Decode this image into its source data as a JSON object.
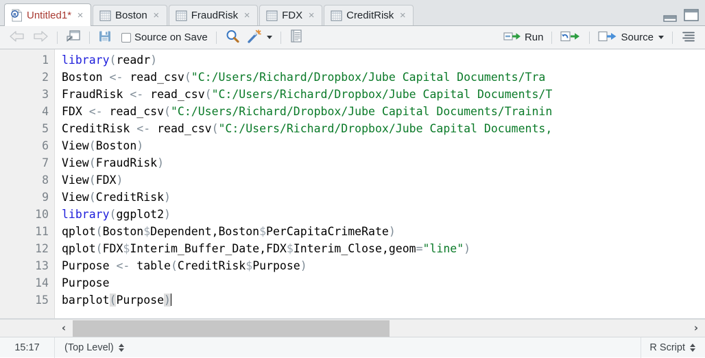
{
  "window": {
    "minimize_label": "minimize-pane",
    "maximize_label": "maximize-pane"
  },
  "tabs": [
    {
      "label": "Untitled1*",
      "icon": "r-script-icon",
      "active": true,
      "close": "×"
    },
    {
      "label": "Boston",
      "icon": "data-grid-icon",
      "active": false,
      "close": "×"
    },
    {
      "label": "FraudRisk",
      "icon": "data-grid-icon",
      "active": false,
      "close": "×"
    },
    {
      "label": "FDX",
      "icon": "data-grid-icon",
      "active": false,
      "close": "×"
    },
    {
      "label": "CreditRisk",
      "icon": "data-grid-icon",
      "active": false,
      "close": "×"
    }
  ],
  "toolbar": {
    "back_icon": "back-arrow-icon",
    "forward_icon": "forward-arrow-icon",
    "popout_icon": "show-in-new-window-icon",
    "save_icon": "save-icon",
    "source_on_save_label": "Source on Save",
    "find_icon": "find-replace-icon",
    "wand_icon": "code-tools-wand-icon",
    "report_icon": "compile-report-icon",
    "run_label": "Run",
    "rerun_icon": "rerun-previous-icon",
    "source_label": "Source",
    "outline_icon": "document-outline-icon"
  },
  "editor": {
    "line_numbers": [
      "1",
      "2",
      "3",
      "4",
      "5",
      "6",
      "7",
      "8",
      "9",
      "10",
      "11",
      "12",
      "13",
      "14",
      "15"
    ],
    "lines": [
      {
        "n": "1",
        "tokens": [
          {
            "t": "library",
            "c": "fn"
          },
          {
            "t": "(",
            "c": "op"
          },
          {
            "t": "readr",
            "c": "txt"
          },
          {
            "t": ")",
            "c": "op"
          }
        ]
      },
      {
        "n": "2",
        "tokens": [
          {
            "t": "Boston ",
            "c": "txt"
          },
          {
            "t": "<-",
            "c": "op"
          },
          {
            "t": " read_csv",
            "c": "txt"
          },
          {
            "t": "(",
            "c": "op"
          },
          {
            "t": "\"C:/Users/Richard/Dropbox/Jube Capital Documents/Tra",
            "c": "str"
          }
        ]
      },
      {
        "n": "3",
        "tokens": [
          {
            "t": "FraudRisk ",
            "c": "txt"
          },
          {
            "t": "<-",
            "c": "op"
          },
          {
            "t": " read_csv",
            "c": "txt"
          },
          {
            "t": "(",
            "c": "op"
          },
          {
            "t": "\"C:/Users/Richard/Dropbox/Jube Capital Documents/T",
            "c": "str"
          }
        ]
      },
      {
        "n": "4",
        "tokens": [
          {
            "t": "FDX ",
            "c": "txt"
          },
          {
            "t": "<-",
            "c": "op"
          },
          {
            "t": " read_csv",
            "c": "txt"
          },
          {
            "t": "(",
            "c": "op"
          },
          {
            "t": "\"C:/Users/Richard/Dropbox/Jube Capital Documents/Trainin",
            "c": "str"
          }
        ]
      },
      {
        "n": "5",
        "tokens": [
          {
            "t": "CreditRisk ",
            "c": "txt"
          },
          {
            "t": "<-",
            "c": "op"
          },
          {
            "t": " read_csv",
            "c": "txt"
          },
          {
            "t": "(",
            "c": "op"
          },
          {
            "t": "\"C:/Users/Richard/Dropbox/Jube Capital Documents,",
            "c": "str"
          }
        ]
      },
      {
        "n": "6",
        "tokens": [
          {
            "t": "View",
            "c": "txt"
          },
          {
            "t": "(",
            "c": "op"
          },
          {
            "t": "Boston",
            "c": "txt"
          },
          {
            "t": ")",
            "c": "op"
          }
        ]
      },
      {
        "n": "7",
        "tokens": [
          {
            "t": "View",
            "c": "txt"
          },
          {
            "t": "(",
            "c": "op"
          },
          {
            "t": "FraudRisk",
            "c": "txt"
          },
          {
            "t": ")",
            "c": "op"
          }
        ]
      },
      {
        "n": "8",
        "tokens": [
          {
            "t": "View",
            "c": "txt"
          },
          {
            "t": "(",
            "c": "op"
          },
          {
            "t": "FDX",
            "c": "txt"
          },
          {
            "t": ")",
            "c": "op"
          }
        ]
      },
      {
        "n": "9",
        "tokens": [
          {
            "t": "View",
            "c": "txt"
          },
          {
            "t": "(",
            "c": "op"
          },
          {
            "t": "CreditRisk",
            "c": "txt"
          },
          {
            "t": ")",
            "c": "op"
          }
        ]
      },
      {
        "n": "10",
        "tokens": [
          {
            "t": "library",
            "c": "fn"
          },
          {
            "t": "(",
            "c": "op"
          },
          {
            "t": "ggplot2",
            "c": "txt"
          },
          {
            "t": ")",
            "c": "op"
          }
        ]
      },
      {
        "n": "11",
        "tokens": [
          {
            "t": "qplot",
            "c": "txt"
          },
          {
            "t": "(",
            "c": "op"
          },
          {
            "t": "Boston",
            "c": "txt"
          },
          {
            "t": "$",
            "c": "dol"
          },
          {
            "t": "Dependent,Boston",
            "c": "txt"
          },
          {
            "t": "$",
            "c": "dol"
          },
          {
            "t": "PerCapitaCrimeRate",
            "c": "txt"
          },
          {
            "t": ")",
            "c": "op"
          }
        ]
      },
      {
        "n": "12",
        "tokens": [
          {
            "t": "qplot",
            "c": "txt"
          },
          {
            "t": "(",
            "c": "op"
          },
          {
            "t": "FDX",
            "c": "txt"
          },
          {
            "t": "$",
            "c": "dol"
          },
          {
            "t": "Interim_Buffer_Date,FDX",
            "c": "txt"
          },
          {
            "t": "$",
            "c": "dol"
          },
          {
            "t": "Interim_Close,geom",
            "c": "txt"
          },
          {
            "t": "=",
            "c": "op"
          },
          {
            "t": "\"line\"",
            "c": "str"
          },
          {
            "t": ")",
            "c": "op"
          }
        ]
      },
      {
        "n": "13",
        "tokens": [
          {
            "t": "Purpose ",
            "c": "txt"
          },
          {
            "t": "<-",
            "c": "op"
          },
          {
            "t": " table",
            "c": "txt"
          },
          {
            "t": "(",
            "c": "op"
          },
          {
            "t": "CreditRisk",
            "c": "txt"
          },
          {
            "t": "$",
            "c": "dol"
          },
          {
            "t": "Purpose",
            "c": "txt"
          },
          {
            "t": ")",
            "c": "op"
          }
        ]
      },
      {
        "n": "14",
        "tokens": [
          {
            "t": "Purpose",
            "c": "txt"
          }
        ]
      },
      {
        "n": "15",
        "tokens": [
          {
            "t": "barplot",
            "c": "txt"
          },
          {
            "t": "(",
            "c": "op",
            "match": true
          },
          {
            "t": "Purpose",
            "c": "txt"
          },
          {
            "t": ")",
            "c": "op",
            "match": true
          },
          {
            "t": "",
            "c": "caret"
          }
        ]
      }
    ]
  },
  "scrollbar": {
    "left_arrow": "‹",
    "right_arrow": "›"
  },
  "statusbar": {
    "cursor_position": "15:17",
    "scope": "(Top Level)",
    "file_type": "R Script"
  },
  "colors": {
    "string_green": "#0a7a28",
    "keyword_blue": "#1c1cdb",
    "operator_gray": "#7e8b96",
    "active_tab_title": "#a93a32",
    "run_arrow_green": "#2e9e42",
    "tab_bar_bg": "#e1e4e7",
    "toolbar_bg": "#f2f3f4",
    "gutter_bg": "#f0f0f0"
  }
}
